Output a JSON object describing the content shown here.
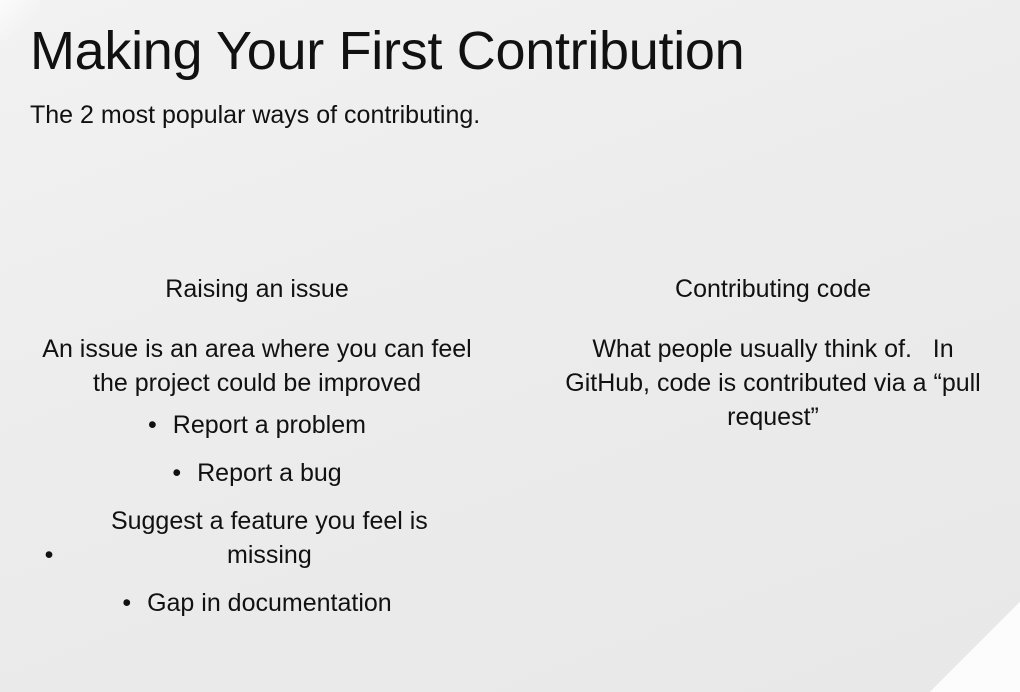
{
  "slide": {
    "title": "Making Your First Contribution",
    "subtitle": "The 2 most popular ways of contributing."
  },
  "left_column": {
    "heading": "Raising an issue",
    "text": "An issue is an area where you can feel the project could be improved",
    "bullets": [
      "Report a problem",
      "Report a bug",
      "Suggest a feature you feel is missing",
      "Gap in documentation"
    ]
  },
  "right_column": {
    "heading": "Contributing code",
    "text": "What people usually think of.   In GitHub, code is contributed via a “pull request”"
  },
  "bullet_glyph": "•"
}
